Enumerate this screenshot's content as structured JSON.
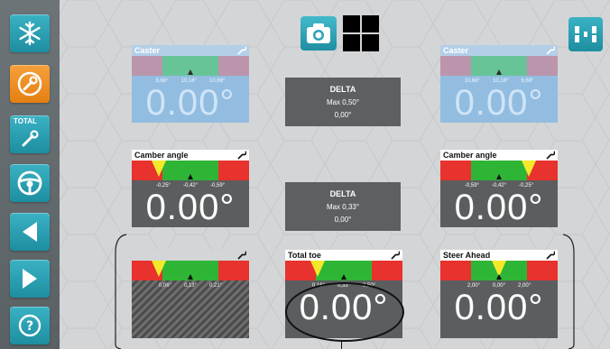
{
  "colors": {
    "teal": "#2aa3b6",
    "orange": "#f28b1e",
    "green": "#2fb536",
    "red": "#e8322d",
    "yellow": "#f3e92a"
  },
  "sidebar": {
    "items": [
      {
        "icon": "snowflake-icon"
      },
      {
        "icon": "wrench-circle-icon"
      },
      {
        "icon": "total-wrench-icon",
        "label": "TOTAL"
      },
      {
        "icon": "steering-wheel-icon"
      },
      {
        "icon": "arrow-left-icon"
      },
      {
        "icon": "arrow-right-icon"
      },
      {
        "icon": "help-icon",
        "label": "?"
      }
    ]
  },
  "top": {
    "camera_icon": "camera-icon",
    "grid_icon": "grid-view-icon",
    "right_icon": "car-axles-icon"
  },
  "caster_left": {
    "title": "Caster",
    "ticks": [
      "9,68°",
      "10,18°",
      "10,68°"
    ],
    "value": "0.00°"
  },
  "caster_right": {
    "title": "Caster",
    "ticks": [
      "10,68°",
      "10,18°",
      "9,68°"
    ],
    "value": "0.00°"
  },
  "delta_top": {
    "title": "DELTA",
    "max": "Max 0,50°",
    "val": "0,00°"
  },
  "camber_left": {
    "title": "Camber angle",
    "ticks": [
      "-0,25°",
      "-0,42°",
      "-0,59°"
    ],
    "value": "0.00°"
  },
  "camber_right": {
    "title": "Camber angle",
    "ticks": [
      "-0,59°",
      "-0,42°",
      "-0,25°"
    ],
    "value": "0.00°"
  },
  "delta_mid": {
    "title": "DELTA",
    "max": "Max 0,33°",
    "val": "0,00°"
  },
  "toe_left": {
    "title": "",
    "ticks": [
      "0,06°",
      "0,13°",
      "0,21°"
    ]
  },
  "total_toe": {
    "title": "Total toe",
    "ticks": [
      "0,16°",
      "0,33°",
      "0,50°"
    ],
    "value": "0.00°"
  },
  "steer_ahead": {
    "title": "Steer Ahead",
    "ticks": [
      "2,00°",
      "0,00°",
      "2,00°"
    ],
    "value": "0.00°"
  }
}
